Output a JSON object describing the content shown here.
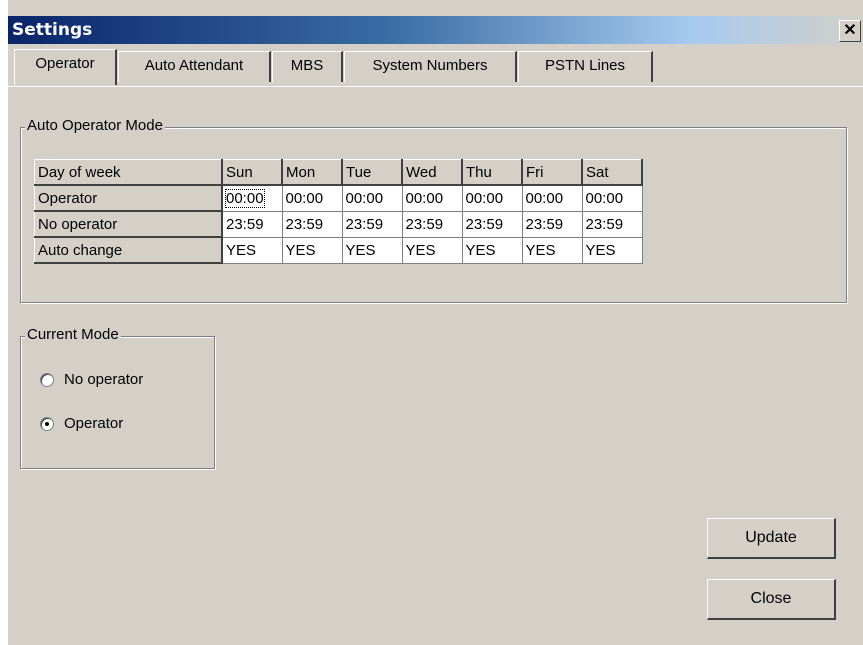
{
  "window": {
    "title": "Settings",
    "close_glyph": "✕"
  },
  "tabs": [
    {
      "label": "Operator",
      "active": true
    },
    {
      "label": "Auto Attendant",
      "active": false
    },
    {
      "label": "MBS",
      "active": false
    },
    {
      "label": "System Numbers",
      "active": false
    },
    {
      "label": "PSTN Lines",
      "active": false
    }
  ],
  "auto_operator": {
    "legend": "Auto Operator Mode",
    "header_label": "Day of week",
    "days": [
      "Sun",
      "Mon",
      "Tue",
      "Wed",
      "Thu",
      "Fri",
      "Sat"
    ],
    "rows": [
      {
        "label": "Operator",
        "values": [
          "00:00",
          "00:00",
          "00:00",
          "00:00",
          "00:00",
          "00:00",
          "00:00"
        ]
      },
      {
        "label": "No operator",
        "values": [
          "23:59",
          "23:59",
          "23:59",
          "23:59",
          "23:59",
          "23:59",
          "23:59"
        ]
      },
      {
        "label": "Auto change",
        "values": [
          "YES",
          "YES",
          "YES",
          "YES",
          "YES",
          "YES",
          "YES"
        ]
      }
    ]
  },
  "current_mode": {
    "legend": "Current Mode",
    "options": [
      {
        "label": "No operator",
        "selected": false
      },
      {
        "label": "Operator",
        "selected": true
      }
    ]
  },
  "buttons": {
    "update": "Update",
    "close": "Close"
  }
}
